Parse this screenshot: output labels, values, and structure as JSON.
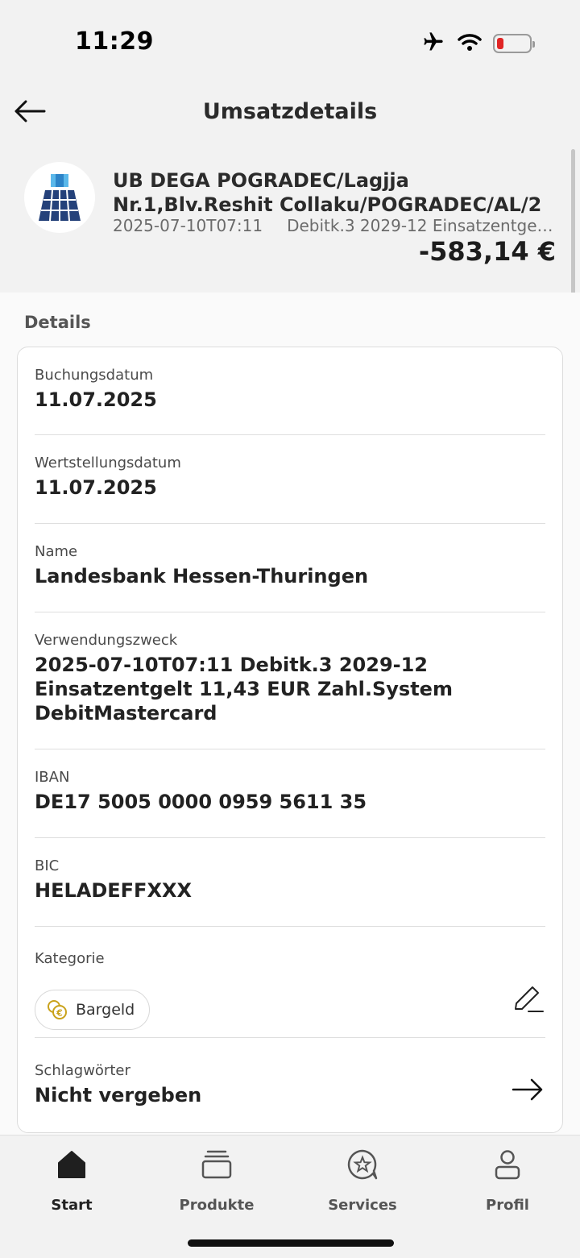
{
  "status_bar": {
    "time": "11:29"
  },
  "header": {
    "title": "Umsatzdetails"
  },
  "transaction": {
    "merchant": "UB DEGA POGRADEC/Lagjja Nr.1,Blv.Reshit Collaku/POGRADEC/AL/2",
    "datetime": "2025-07-10T07:11",
    "reference_preview": "Debitk.3 2029-12 Einsatzentgelt 11,43 EUR Zahl.System DebitMastercard",
    "amount": "-583,14 €"
  },
  "details": {
    "section_title": "Details",
    "booking_date": {
      "label": "Buchungsdatum",
      "value": "11.07.2025"
    },
    "value_date": {
      "label": "Wertstellungsdatum",
      "value": "11.07.2025"
    },
    "name": {
      "label": "Name",
      "value": "Landesbank Hessen-Thuringen"
    },
    "purpose": {
      "label": "Verwendungszweck",
      "value": "2025-07-10T07:11 Debitk.3 2029-12 Einsatzentgelt 11,43 EUR Zahl.System DebitMastercard"
    },
    "iban": {
      "label": "IBAN",
      "value": "DE17 5005 0000 0959 5611 35"
    },
    "bic": {
      "label": "BIC",
      "value": "HELADEFFXXX"
    },
    "category": {
      "label": "Kategorie",
      "value": "Bargeld",
      "icon": "coins-euro-icon"
    },
    "tags": {
      "label": "Schlagwörter",
      "value": "Nicht vergeben"
    }
  },
  "tab_bar": {
    "tabs": [
      {
        "label": "Start",
        "icon": "home-icon",
        "active": true
      },
      {
        "label": "Produkte",
        "icon": "cards-stack-icon",
        "active": false
      },
      {
        "label": "Services",
        "icon": "services-star-icon",
        "active": false
      },
      {
        "label": "Profil",
        "icon": "person-icon",
        "active": false
      }
    ]
  },
  "colors": {
    "battery_low": "#e02424",
    "category_icon": "#c9a21b"
  }
}
